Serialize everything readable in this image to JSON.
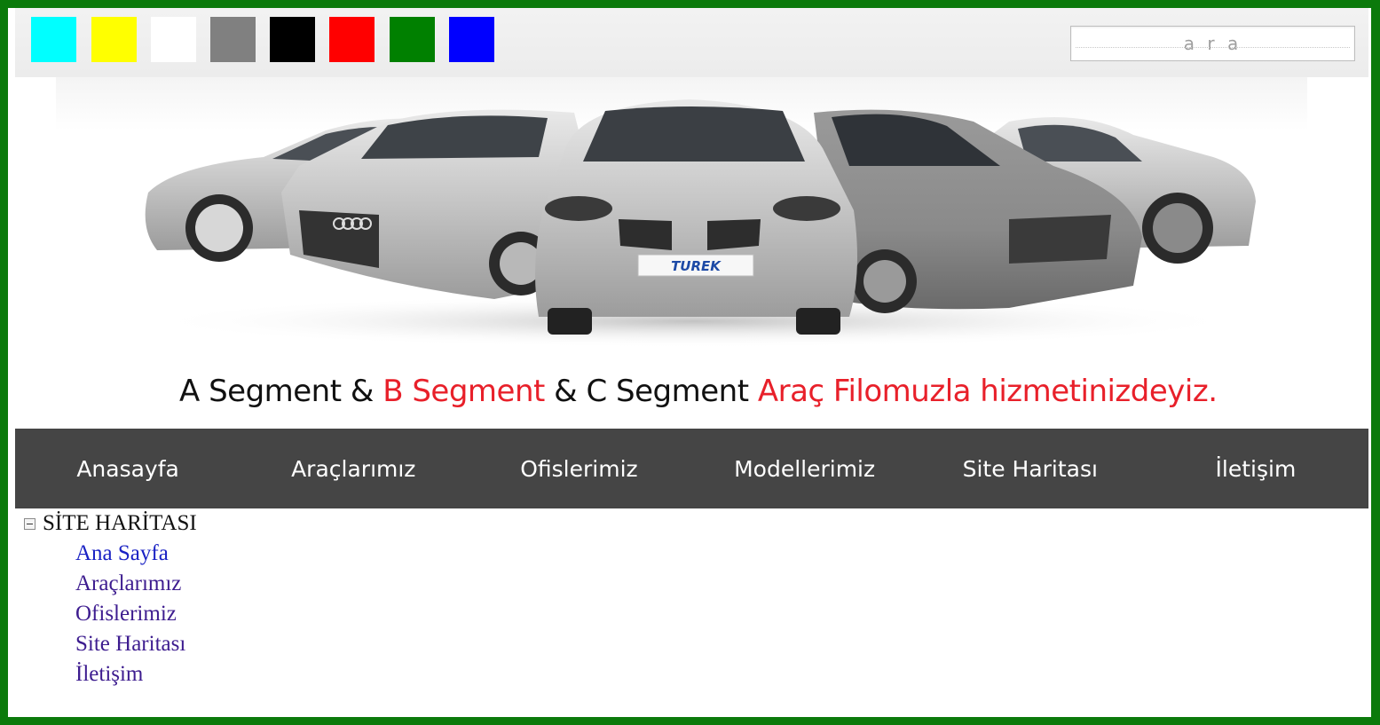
{
  "colors": {
    "frame": "#0b7a0b",
    "nav_bg": "#454545",
    "tagline_red": "#e8202a"
  },
  "swatches": [
    {
      "name": "cyan-swatch",
      "color": "#00ffff"
    },
    {
      "name": "yellow-swatch",
      "color": "#ffff00"
    },
    {
      "name": "white-swatch",
      "color": "#ffffff"
    },
    {
      "name": "gray-swatch",
      "color": "#808080"
    },
    {
      "name": "black-swatch",
      "color": "#000000"
    },
    {
      "name": "red-swatch",
      "color": "#ff0000"
    },
    {
      "name": "green-swatch",
      "color": "#008000"
    },
    {
      "name": "blue-swatch",
      "color": "#0000ff"
    }
  ],
  "search": {
    "placeholder": "a r a"
  },
  "banner": {
    "plate_text": "TUREK",
    "tagline": {
      "part1": "A Segment & ",
      "part2": "B Segment",
      "part3": " & C Segment ",
      "part4": "Araç Filomuzla hizmetinizdeyiz."
    }
  },
  "nav": {
    "items": [
      {
        "label": "Anasayfa"
      },
      {
        "label": "Araçlarımız"
      },
      {
        "label": "Ofislerimiz"
      },
      {
        "label": "Modellerimiz"
      },
      {
        "label": "Site Haritası"
      },
      {
        "label": "İletişim"
      }
    ]
  },
  "sitemap": {
    "root": "SİTE HARİTASI",
    "links": [
      {
        "label": "Ana Sayfa"
      },
      {
        "label": "Araçlarımız"
      },
      {
        "label": "Ofislerimiz"
      },
      {
        "label": "Site Haritası"
      },
      {
        "label": "İletişim"
      }
    ]
  }
}
